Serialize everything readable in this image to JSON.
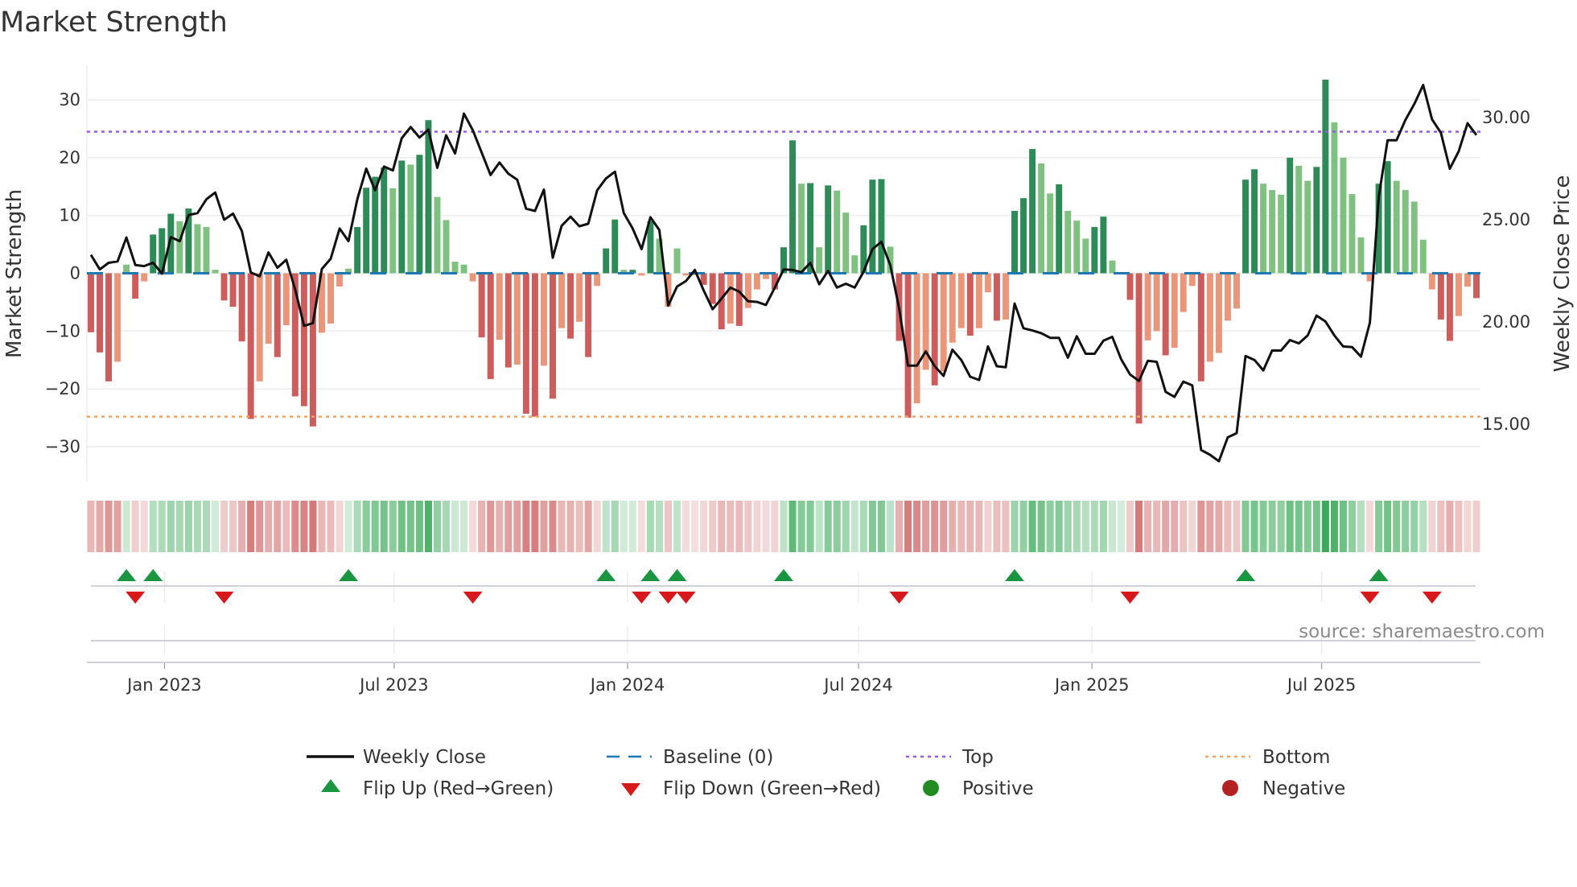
{
  "chart_data": {
    "type": "bar",
    "title": "Market Strength",
    "ylabel": "Market Strength",
    "y2label": "Weekly Close Price",
    "ylim": [
      -36,
      36
    ],
    "y2lim": [
      12.2,
      32.56
    ],
    "yticks": [
      -30,
      -20,
      -10,
      0,
      10,
      20,
      30
    ],
    "y2ticks": [
      "15.00",
      "20.00",
      "25.00",
      "30.00"
    ],
    "start_date": "2022-11-04",
    "frequency": "weekly",
    "xticks": [
      {
        "label": "Jan 2023",
        "date": "2023-01-01"
      },
      {
        "label": "Jul 2023",
        "date": "2023-07-01"
      },
      {
        "label": "Jan 2024",
        "date": "2024-01-01"
      },
      {
        "label": "Jul 2024",
        "date": "2024-07-01"
      },
      {
        "label": "Jan 2025",
        "date": "2025-01-01"
      },
      {
        "label": "Jul 2025",
        "date": "2025-07-01"
      }
    ],
    "top_level": 24.5,
    "bottom_level": -24.8,
    "strength": [
      -10.2,
      -13.7,
      -18.7,
      -15.3,
      1.5,
      -4.4,
      -1.4,
      6.7,
      7.8,
      10.3,
      9.0,
      11.2,
      8.5,
      8.0,
      0.6,
      -4.7,
      -5.8,
      -11.8,
      -25.2,
      -18.7,
      -12.2,
      -14.5,
      -9.0,
      -21.3,
      -23.0,
      -26.5,
      -10.3,
      -8.7,
      -2.3,
      0.8,
      8.0,
      14.8,
      16.7,
      18.3,
      14.7,
      19.5,
      18.8,
      20.5,
      26.5,
      13.2,
      9.2,
      2.0,
      1.5,
      -1.4,
      -11.1,
      -18.3,
      -11.5,
      -16.3,
      -15.8,
      -24.3,
      -24.8,
      -16.0,
      -21.7,
      -9.5,
      -11.3,
      -8.4,
      -14.5,
      -2.2,
      4.3,
      9.3,
      0.6,
      0.6,
      -0.4,
      9.0,
      6.0,
      -5.8,
      4.3,
      -0.4,
      -0.3,
      -2.0,
      -5.3,
      -9.7,
      -8.7,
      -9.1,
      -6.0,
      -2.8,
      -1.0,
      -2.8,
      4.5,
      23.0,
      15.5,
      15.6,
      4.5,
      15.2,
      14.3,
      10.5,
      3.1,
      8.3,
      16.2,
      16.3,
      4.6,
      -11.7,
      -25.0,
      -22.5,
      -16.7,
      -19.4,
      -17.0,
      -12.0,
      -9.5,
      -10.8,
      -9.5,
      -3.3,
      -8.2,
      -8.0,
      10.8,
      13.0,
      21.5,
      19.0,
      13.8,
      15.4,
      10.8,
      9.1,
      6.0,
      8.0,
      9.8,
      2.2,
      0.0,
      -4.6,
      -26.0,
      -11.6,
      -10.0,
      -14.2,
      -12.9,
      -6.7,
      -2.2,
      -18.7,
      -15.3,
      -13.8,
      -8.2,
      -6.1,
      16.2,
      18.0,
      15.5,
      14.4,
      13.6,
      20.0,
      18.6,
      16.0,
      18.4,
      33.5,
      26.1,
      20.0,
      13.7,
      6.2,
      -1.4,
      15.5,
      19.4,
      16.0,
      14.4,
      12.4,
      5.8,
      -2.8,
      -8.0,
      -11.7,
      -7.4,
      -2.3,
      -4.3
    ],
    "weekly_close": [
      23.28,
      22.57,
      22.89,
      22.96,
      24.13,
      22.78,
      22.73,
      22.9,
      22.36,
      24.15,
      23.95,
      25.23,
      25.32,
      26.0,
      26.33,
      25.0,
      25.3,
      24.45,
      22.42,
      22.23,
      23.4,
      22.65,
      23.04,
      21.58,
      19.81,
      19.94,
      22.59,
      23.09,
      24.57,
      23.95,
      26.0,
      27.5,
      26.44,
      27.6,
      27.41,
      28.99,
      29.53,
      29.02,
      29.41,
      27.54,
      29.13,
      28.24,
      30.19,
      29.38,
      28.28,
      27.19,
      27.8,
      27.25,
      26.96,
      25.54,
      25.43,
      26.47,
      23.14,
      24.7,
      25.15,
      24.68,
      24.8,
      26.44,
      27.02,
      27.35,
      25.32,
      24.57,
      23.56,
      25.12,
      24.49,
      20.8,
      21.73,
      22.0,
      22.54,
      21.53,
      20.62,
      21.14,
      21.68,
      21.48,
      21.01,
      20.98,
      20.83,
      21.68,
      22.57,
      22.54,
      22.43,
      22.89,
      21.84,
      22.5,
      21.68,
      21.87,
      21.68,
      22.46,
      23.56,
      23.92,
      22.78,
      20.67,
      17.86,
      17.86,
      18.56,
      17.83,
      17.36,
      18.64,
      18.13,
      17.32,
      17.16,
      18.8,
      17.83,
      17.78,
      20.9,
      19.69,
      19.58,
      19.45,
      19.22,
      19.22,
      18.25,
      19.3,
      18.44,
      18.44,
      19.08,
      19.27,
      18.17,
      17.43,
      17.11,
      18.1,
      18.05,
      16.58,
      16.33,
      17.08,
      16.9,
      13.73,
      13.5,
      13.18,
      14.35,
      14.56,
      18.33,
      18.14,
      17.63,
      18.6,
      18.6,
      19.11,
      18.95,
      19.34,
      20.31,
      20.02,
      19.34,
      18.8,
      18.77,
      18.3,
      19.97,
      26.13,
      28.89,
      28.89,
      29.88,
      30.66,
      31.59,
      29.91,
      29.25,
      27.49,
      28.35,
      29.72,
      29.14
    ],
    "flip_up_indices": [
      4,
      7,
      29,
      58,
      63,
      66,
      78,
      104,
      130,
      145
    ],
    "flip_down_indices": [
      5,
      15,
      43,
      62,
      65,
      67,
      91,
      117,
      144,
      151
    ],
    "legend": {
      "weekly_close": "Weekly Close",
      "baseline": "Baseline (0)",
      "top": "Top",
      "bottom": "Bottom",
      "flip_up": "Flip Up (Red→Green)",
      "flip_down": "Flip Down (Green→Red)",
      "positive": "Positive",
      "negative": "Negative"
    },
    "legend_placement": "bottom",
    "grid": true,
    "source": "source: sharemaestro.com"
  },
  "colors": {
    "pos_strong": "#2e8b57",
    "pos_weak": "#80c080",
    "neg_strong": "#cd5c5c",
    "neg_weak": "#e9967a",
    "line": "#111111",
    "baseline": "#1f77b4",
    "top": "#9b59e6",
    "bottom": "#f4a460",
    "flip_up": "#1a9641",
    "flip_down": "#d7191c",
    "positive_dot": "#228b22",
    "negative_dot": "#b22222"
  }
}
